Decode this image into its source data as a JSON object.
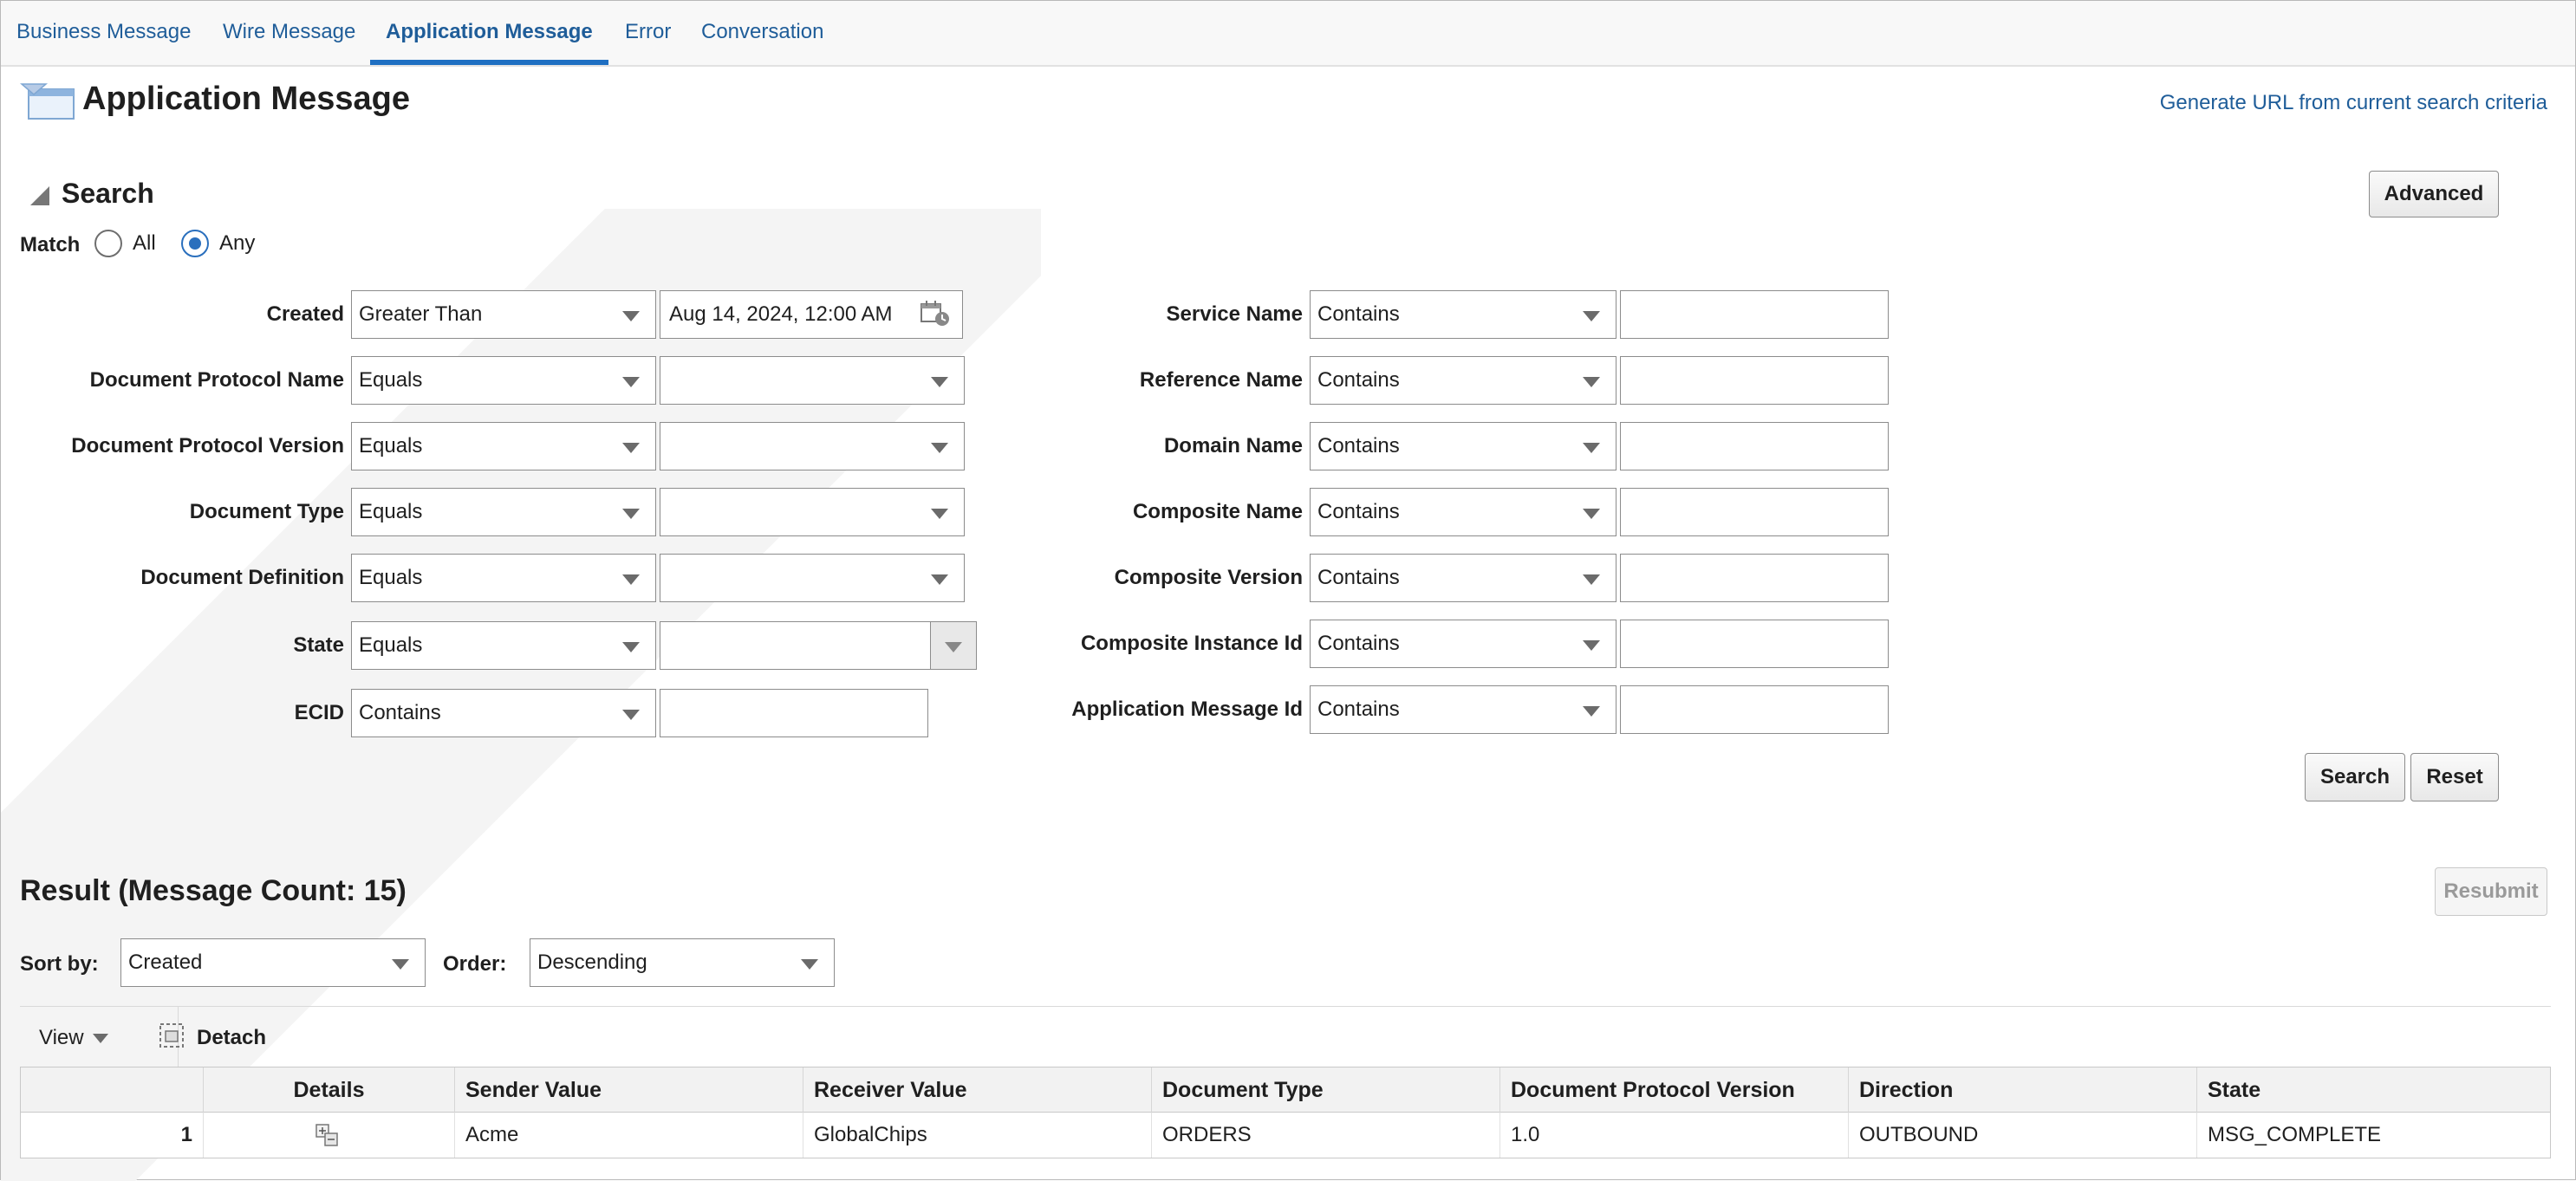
{
  "tabs": [
    {
      "label": "Business Message"
    },
    {
      "label": "Wire Message"
    },
    {
      "label": "Application Message"
    },
    {
      "label": "Error"
    },
    {
      "label": "Conversation"
    }
  ],
  "header": {
    "title": "Application Message",
    "generate_url_link": "Generate URL from current search criteria"
  },
  "search": {
    "heading": "Search",
    "advanced_button": "Advanced",
    "match_label": "Match",
    "match_all": "All",
    "match_any": "Any",
    "match_selected": "Any",
    "search_button": "Search",
    "reset_button": "Reset",
    "left_fields": [
      {
        "label": "Created",
        "operator": "Greater Than",
        "value": "Aug 14, 2024, 12:00 AM"
      },
      {
        "label": "Document Protocol Name",
        "operator": "Equals",
        "value": ""
      },
      {
        "label": "Document Protocol Version",
        "operator": "Equals",
        "value": ""
      },
      {
        "label": "Document Type",
        "operator": "Equals",
        "value": ""
      },
      {
        "label": "Document Definition",
        "operator": "Equals",
        "value": ""
      },
      {
        "label": "State",
        "operator": "Equals",
        "value": ""
      },
      {
        "label": "ECID",
        "operator": "Contains",
        "value": ""
      }
    ],
    "right_fields": [
      {
        "label": "Service Name",
        "operator": "Contains",
        "value": ""
      },
      {
        "label": "Reference Name",
        "operator": "Contains",
        "value": ""
      },
      {
        "label": "Domain Name",
        "operator": "Contains",
        "value": ""
      },
      {
        "label": "Composite Name",
        "operator": "Contains",
        "value": ""
      },
      {
        "label": "Composite Version",
        "operator": "Contains",
        "value": ""
      },
      {
        "label": "Composite Instance Id",
        "operator": "Contains",
        "value": ""
      },
      {
        "label": "Application Message Id",
        "operator": "Contains",
        "value": ""
      }
    ]
  },
  "result": {
    "title": "Result (Message Count: 15)",
    "resubmit_button": "Resubmit",
    "sort_by_label": "Sort by:",
    "sort_by_value": "Created",
    "order_label": "Order:",
    "order_value": "Descending",
    "view_menu": "View",
    "detach_button": "Detach",
    "columns": [
      "Details",
      "Sender Value",
      "Receiver Value",
      "Document Type",
      "Document Protocol Version",
      "Direction",
      "State"
    ],
    "rows": [
      {
        "index": "1",
        "sender": "Acme",
        "receiver": "GlobalChips",
        "doc_type": "ORDERS",
        "protocol_version": "1.0",
        "direction": "OUTBOUND",
        "state": "MSG_COMPLETE"
      }
    ]
  },
  "colors": {
    "link": "#1f5d99",
    "active_tab_underline": "#1f6fc2",
    "radio_selected": "#2a6fbd"
  }
}
